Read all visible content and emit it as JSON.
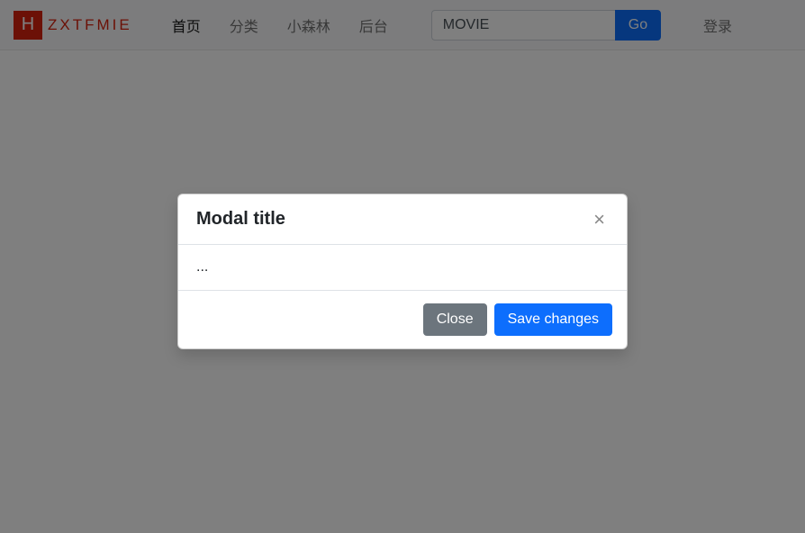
{
  "brand": {
    "badge_letter": "H",
    "text": "ZXTFMIE"
  },
  "nav": {
    "items": [
      {
        "label": "首页",
        "active": true
      },
      {
        "label": "分类",
        "active": false
      },
      {
        "label": "小森林",
        "active": false
      },
      {
        "label": "后台",
        "active": false
      }
    ]
  },
  "search": {
    "value": "MOVIE",
    "button_label": "Go"
  },
  "right_nav": {
    "login_label": "登录"
  },
  "modal": {
    "title": "Modal title",
    "close_symbol": "×",
    "body_text": "...",
    "close_button_label": "Close",
    "save_button_label": "Save changes"
  }
}
